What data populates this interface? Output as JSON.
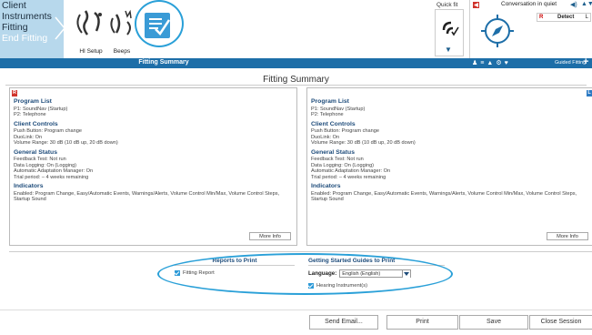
{
  "nav": {
    "steps": [
      "Client",
      "Instruments",
      "Fitting",
      "End Fitting"
    ]
  },
  "tools": {
    "hi_setup": "HI Setup",
    "beeps": "Beeps"
  },
  "quickfit": {
    "label": "Quick fit"
  },
  "connection": {
    "status": "Conversation in quiet",
    "detect_left": "R",
    "detect_label": "Detect",
    "detect_right": "L"
  },
  "header_bar": {
    "title": "Fitting Summary",
    "guided": "Guided Fitting"
  },
  "main": {
    "title": "Fitting Summary"
  },
  "left_panel": {
    "tag": "R",
    "program_list_title": "Program List",
    "programs": [
      "P1: SoundNav (Startup)",
      "P2: Telephone"
    ],
    "client_controls_title": "Client Controls",
    "client_controls": [
      "Push Button: Program change",
      "DuoLink: On",
      "Volume Range: 30 dB (10 dB up, 20 dB down)"
    ],
    "general_status_title": "General Status",
    "general_status": [
      "Feedback Test: Not run",
      "Data Logging: On (Logging)",
      "Automatic Adaptation Manager: On",
      "Trial period: – 4 weeks remaining"
    ],
    "indicators_title": "Indicators",
    "indicators": [
      "Enabled: Program Change, Easy/Automatic Events, Warnings/Alerts, Volume Control Min/Max, Volume Control Steps, Startup Sound"
    ],
    "more_info": "More Info"
  },
  "right_panel": {
    "tag": "L",
    "program_list_title": "Program List",
    "programs": [
      "P1: SoundNav (Startup)",
      "P2: Telephone"
    ],
    "client_controls_title": "Client Controls",
    "client_controls": [
      "Push Button: Program change",
      "DuoLink: On",
      "Volume Range: 30 dB (10 dB up, 20 dB down)"
    ],
    "general_status_title": "General Status",
    "general_status": [
      "Feedback Test: Not run",
      "Data Logging: On (Logging)",
      "Automatic Adaptation Manager: On",
      "Trial period: – 4 weeks remaining"
    ],
    "indicators_title": "Indicators",
    "indicators": [
      "Enabled: Program Change, Easy/Automatic Events, Warnings/Alerts, Volume Control Min/Max, Volume Control Steps, Startup Sound"
    ],
    "more_info": "More Info"
  },
  "reports": {
    "title": "Reports to Print",
    "fitting_report": "Fitting Report"
  },
  "guides": {
    "title": "Getting Started Guides to Print",
    "language_label": "Language:",
    "language_value": "English (English)",
    "hearing_instruments": "Hearing Instrument(s)"
  },
  "buttons": {
    "send_email": "Send Email...",
    "print": "Print",
    "save": "Save",
    "close_session": "Close Session"
  },
  "colors": {
    "accent_blue": "#1d6ea8",
    "nav_bg": "#b7d8ec",
    "highlight_circle": "#2aa0d8",
    "right_tag": "#d0342c",
    "left_tag": "#2d7bc4"
  }
}
